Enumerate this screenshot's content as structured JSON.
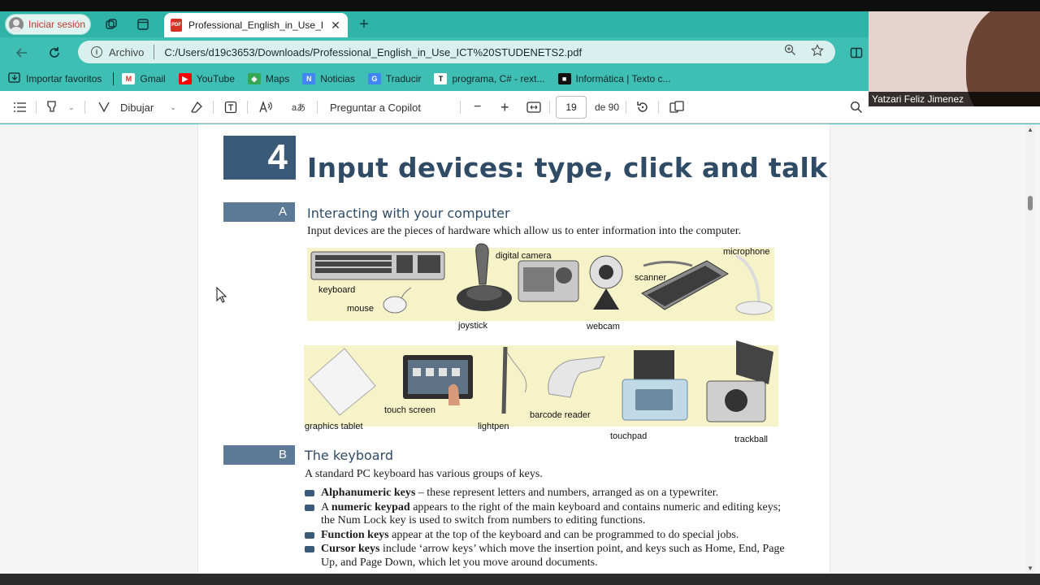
{
  "browser": {
    "profile_label": "Iniciar sesión",
    "tab_title": "Professional_English_in_Use_ICT S",
    "tab_close": "✕",
    "new_tab": "+",
    "address_scheme_label": "Archivo",
    "url": "C:/Users/d19c3653/Downloads/Professional_English_in_Use_ICT%20STUDENETS2.pdf"
  },
  "bookmarks": [
    {
      "label": "Importar favoritos",
      "icon": "import-icon",
      "color": "#13282a"
    },
    {
      "label": "Gmail",
      "icon": "gmail-icon",
      "color": "#d93025"
    },
    {
      "label": "YouTube",
      "icon": "youtube-icon",
      "color": "#ff0000"
    },
    {
      "label": "Maps",
      "icon": "maps-icon",
      "color": "#34a853"
    },
    {
      "label": "Noticias",
      "icon": "news-icon",
      "color": "#4285f4"
    },
    {
      "label": "Traducir",
      "icon": "translate-icon",
      "color": "#4285f4"
    },
    {
      "label": "programa, C# - rext...",
      "icon": "t-icon",
      "color": "#111111"
    },
    {
      "label": "Informática | Texto c...",
      "icon": "bag-icon",
      "color": "#111111"
    }
  ],
  "pdf_toolbar": {
    "draw_label": "Dibujar",
    "copilot_label": "Preguntar a Copilot",
    "zoom_out": "−",
    "zoom_in": "+",
    "page_number": "19",
    "page_total": "de 90"
  },
  "document": {
    "unit_number": "4",
    "unit_title": "Input devices: type, click and talk!",
    "section_a": {
      "letter": "A",
      "title": "Interacting with your computer",
      "intro": "Input devices are the pieces of hardware which allow us to enter information into the computer."
    },
    "row1_labels": [
      "keyboard",
      "mouse",
      "joystick",
      "digital camera",
      "webcam",
      "scanner",
      "microphone"
    ],
    "row2_labels": [
      "graphics tablet",
      "touch screen",
      "lightpen",
      "barcode reader",
      "touchpad",
      "trackball"
    ],
    "section_b": {
      "letter": "B",
      "title": "The keyboard",
      "intro": "A standard PC keyboard has various groups of keys."
    },
    "bullets": [
      {
        "term": "Alphanumeric keys",
        "text": " – these represent letters and numbers, arranged as on a typewriter."
      },
      {
        "term": "numeric keypad",
        "prefix": "A ",
        "text": " appears to the right of the main keyboard and contains numeric and editing keys; the Num Lock key is used to switch from numbers to editing functions."
      },
      {
        "term": "Function keys",
        "text": " appear at the top of the keyboard and can be programmed to do special jobs."
      },
      {
        "term": "Cursor keys",
        "text": " include ‘arrow keys’ which move the insertion point, and keys such as Home, End, Page Up, and Page Down, which let you move around documents."
      }
    ]
  },
  "webcam": {
    "participant_name": "Yatzari Feliz Jimenez"
  },
  "colors": {
    "browser_accent": "#3fbfb3",
    "unit_box": "#3a5a78",
    "heading_text": "#2f4b66"
  }
}
